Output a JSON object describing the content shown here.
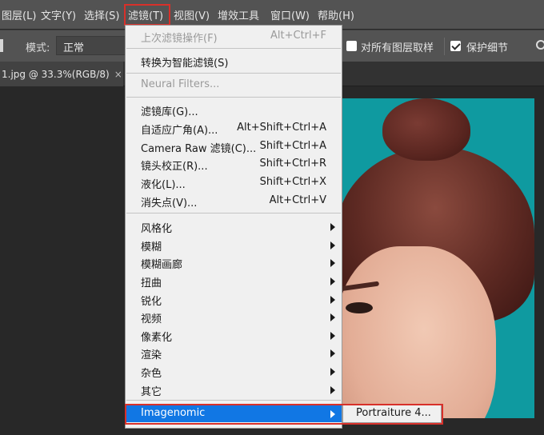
{
  "menubar": {
    "items": [
      "图层(L)",
      "文字(Y)",
      "选择(S)",
      "滤镜(T)",
      "视图(V)",
      "增效工具",
      "窗口(W)",
      "帮助(H)"
    ],
    "active_index": 3,
    "highlight_color": "#d8302a"
  },
  "options_bar": {
    "mode_label": "模式:",
    "mode_value": "正常",
    "sample_all_layers_label": "对所有图层取样",
    "sample_all_layers_checked": false,
    "protect_detail_label": "保护细节",
    "protect_detail_checked": true,
    "settings_icon": "gear-icon"
  },
  "tabs": {
    "document_tab_label": "1.jpg @ 33.3%(RGB/8)",
    "close_label": "×"
  },
  "filter_menu": {
    "items": [
      {
        "label": "上次滤镜操作(F)",
        "shortcut": "Alt+Ctrl+F",
        "disabled": true,
        "submenu": false
      },
      {
        "label": "转换为智能滤镜(S)",
        "shortcut": "",
        "disabled": false,
        "submenu": false
      },
      {
        "label": "Neural Filters...",
        "shortcut": "",
        "disabled": true,
        "submenu": false
      },
      {
        "label": "滤镜库(G)...",
        "shortcut": "",
        "disabled": false,
        "submenu": false
      },
      {
        "label": "自适应广角(A)...",
        "shortcut": "Alt+Shift+Ctrl+A",
        "disabled": false,
        "submenu": false
      },
      {
        "label": "Camera Raw 滤镜(C)...",
        "shortcut": "Shift+Ctrl+A",
        "disabled": false,
        "submenu": false
      },
      {
        "label": "镜头校正(R)...",
        "shortcut": "Shift+Ctrl+R",
        "disabled": false,
        "submenu": false
      },
      {
        "label": "液化(L)...",
        "shortcut": "Shift+Ctrl+X",
        "disabled": false,
        "submenu": false
      },
      {
        "label": "消失点(V)...",
        "shortcut": "Alt+Ctrl+V",
        "disabled": false,
        "submenu": false
      },
      {
        "label": "风格化",
        "shortcut": "",
        "disabled": false,
        "submenu": true
      },
      {
        "label": "模糊",
        "shortcut": "",
        "disabled": false,
        "submenu": true
      },
      {
        "label": "模糊画廊",
        "shortcut": "",
        "disabled": false,
        "submenu": true
      },
      {
        "label": "扭曲",
        "shortcut": "",
        "disabled": false,
        "submenu": true
      },
      {
        "label": "锐化",
        "shortcut": "",
        "disabled": false,
        "submenu": true
      },
      {
        "label": "视频",
        "shortcut": "",
        "disabled": false,
        "submenu": true
      },
      {
        "label": "像素化",
        "shortcut": "",
        "disabled": false,
        "submenu": true
      },
      {
        "label": "渲染",
        "shortcut": "",
        "disabled": false,
        "submenu": true
      },
      {
        "label": "杂色",
        "shortcut": "",
        "disabled": false,
        "submenu": true
      },
      {
        "label": "其它",
        "shortcut": "",
        "disabled": false,
        "submenu": true
      },
      {
        "label": "Imagenomic",
        "shortcut": "",
        "disabled": false,
        "submenu": true,
        "highlighted": true
      }
    ],
    "highlight_color": "#1177e4"
  },
  "imagenomic_submenu": {
    "items": [
      "Portraiture 4..."
    ]
  }
}
